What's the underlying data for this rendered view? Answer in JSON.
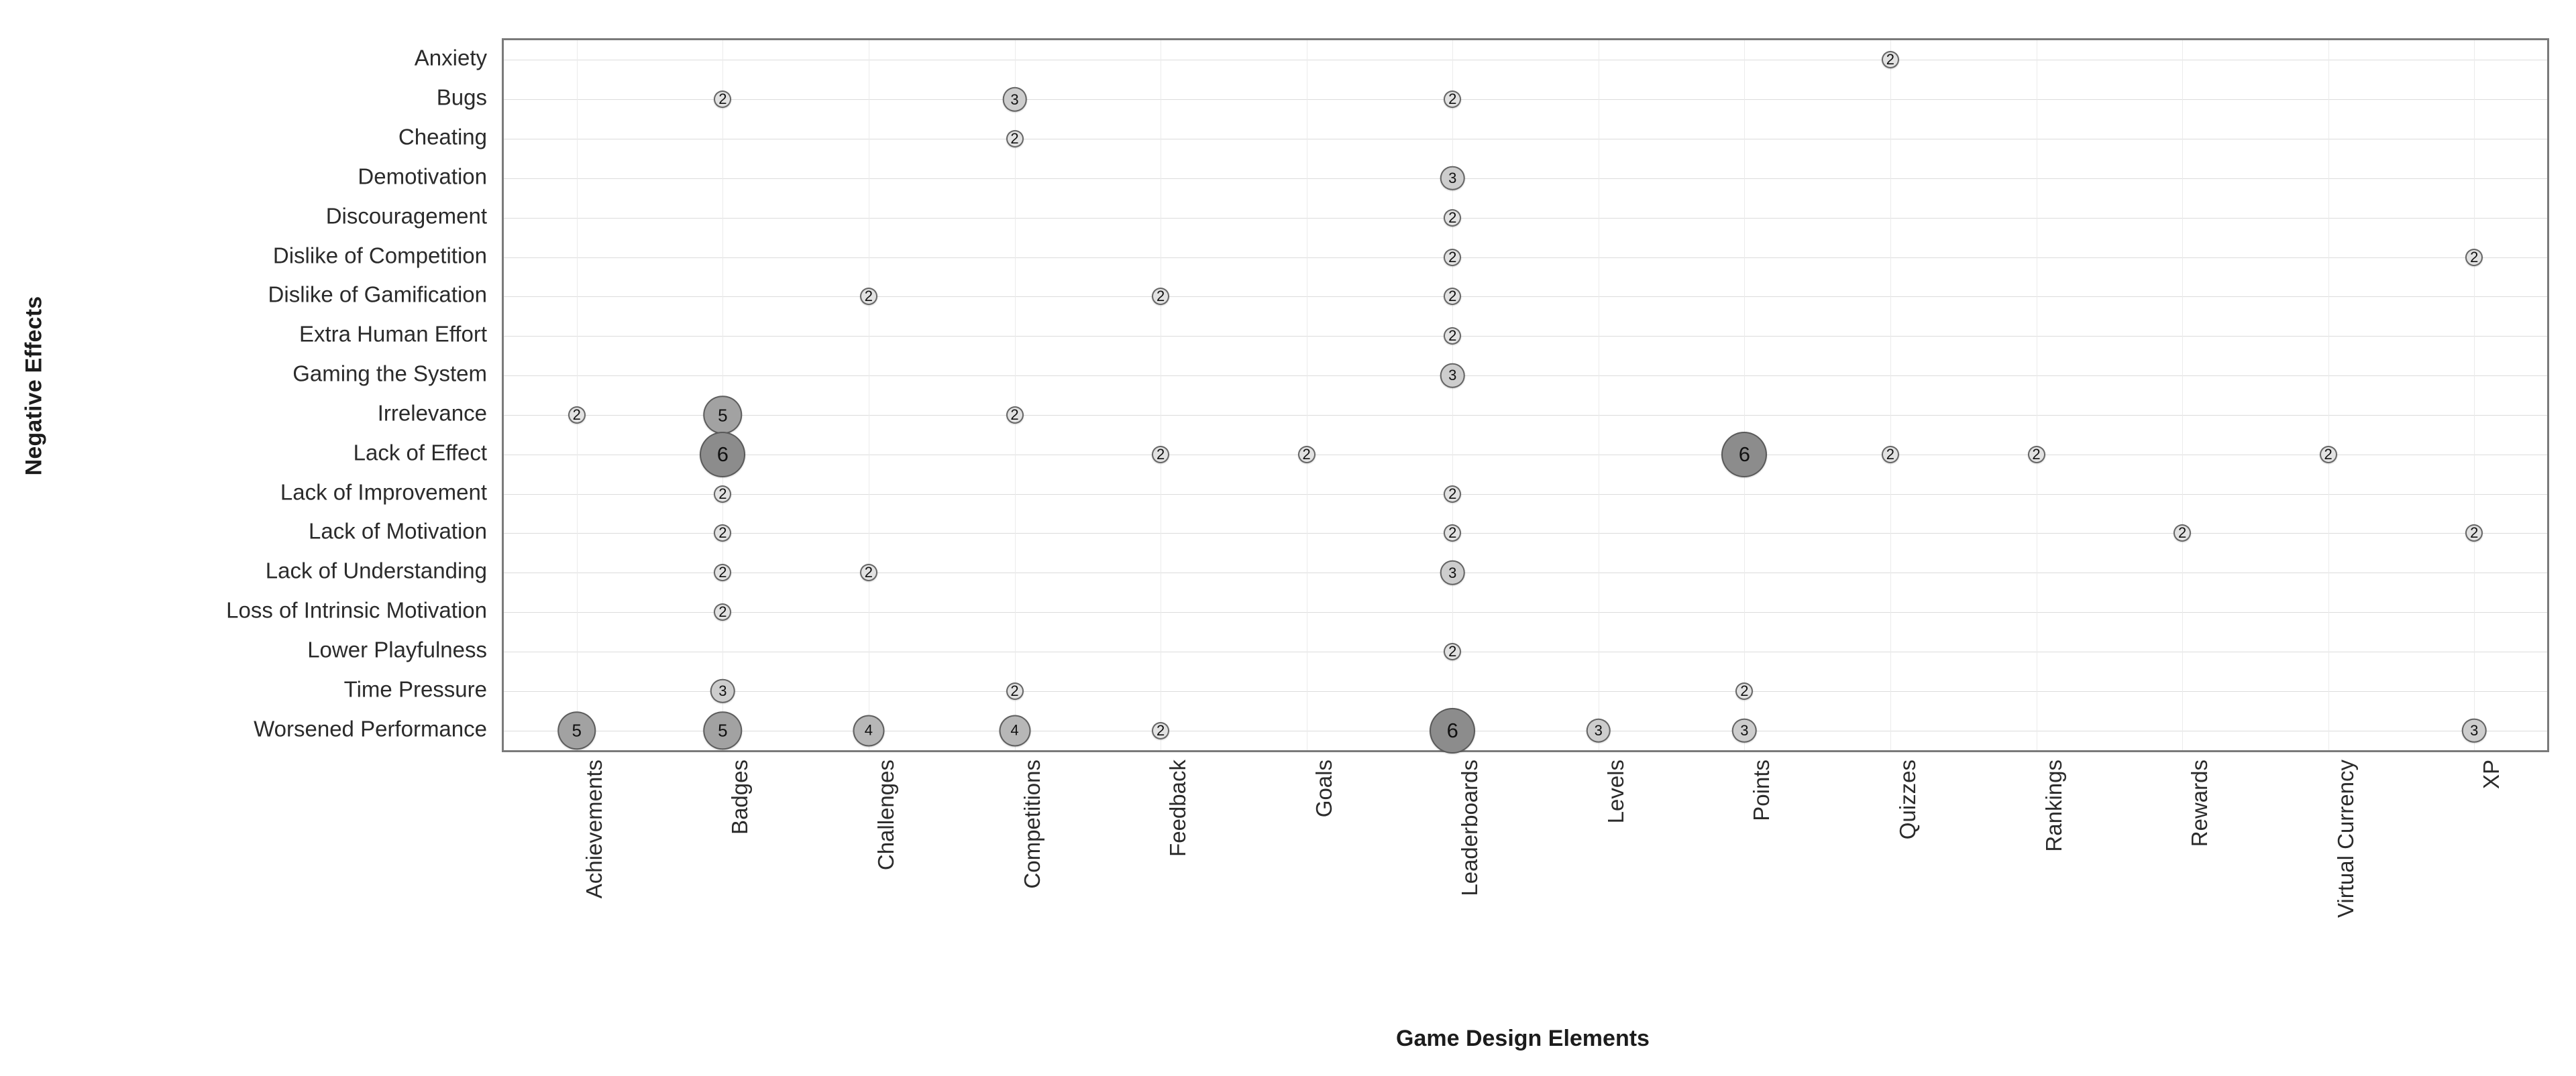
{
  "chart_data": {
    "type": "scatter",
    "title": "",
    "xlabel": "Game Design Elements",
    "ylabel": "Negative Effects",
    "grid": true,
    "legend": "none",
    "categories_x": [
      "Achievements",
      "Badges",
      "Challenges",
      "Competitions",
      "Feedback",
      "Goals",
      "Leaderboards",
      "Levels",
      "Points",
      "Quizzes",
      "Rankings",
      "Rewards",
      "Virtual Currency",
      "XP"
    ],
    "categories_y": [
      "Anxiety",
      "Bugs",
      "Cheating",
      "Demotivation",
      "Discouragement",
      "Dislike of Competition",
      "Dislike of Gamification",
      "Extra Human Effort",
      "Gaming the System",
      "Irrelevance",
      "Lack of Effect",
      "Lack of Improvement",
      "Lack of Motivation",
      "Lack of Understanding",
      "Loss of Intrinsic Motivation",
      "Lower Playfulness",
      "Time Pressure",
      "Worsened Performance"
    ],
    "value_range": [
      2,
      6
    ],
    "points": [
      {
        "x": "Quizzes",
        "y": "Anxiety",
        "value": 2
      },
      {
        "x": "Badges",
        "y": "Bugs",
        "value": 2
      },
      {
        "x": "Competitions",
        "y": "Bugs",
        "value": 3
      },
      {
        "x": "Leaderboards",
        "y": "Bugs",
        "value": 2
      },
      {
        "x": "Competitions",
        "y": "Cheating",
        "value": 2
      },
      {
        "x": "Leaderboards",
        "y": "Demotivation",
        "value": 3
      },
      {
        "x": "Leaderboards",
        "y": "Discouragement",
        "value": 2
      },
      {
        "x": "Leaderboards",
        "y": "Dislike of Competition",
        "value": 2
      },
      {
        "x": "XP",
        "y": "Dislike of Competition",
        "value": 2
      },
      {
        "x": "Challenges",
        "y": "Dislike of Gamification",
        "value": 2
      },
      {
        "x": "Feedback",
        "y": "Dislike of Gamification",
        "value": 2
      },
      {
        "x": "Leaderboards",
        "y": "Dislike of Gamification",
        "value": 2
      },
      {
        "x": "Leaderboards",
        "y": "Extra Human Effort",
        "value": 2
      },
      {
        "x": "Leaderboards",
        "y": "Gaming the System",
        "value": 3
      },
      {
        "x": "Achievements",
        "y": "Irrelevance",
        "value": 2
      },
      {
        "x": "Badges",
        "y": "Irrelevance",
        "value": 5
      },
      {
        "x": "Competitions",
        "y": "Irrelevance",
        "value": 2
      },
      {
        "x": "Badges",
        "y": "Lack of Effect",
        "value": 6
      },
      {
        "x": "Feedback",
        "y": "Lack of Effect",
        "value": 2
      },
      {
        "x": "Goals",
        "y": "Lack of Effect",
        "value": 2
      },
      {
        "x": "Points",
        "y": "Lack of Effect",
        "value": 6
      },
      {
        "x": "Quizzes",
        "y": "Lack of Effect",
        "value": 2
      },
      {
        "x": "Rankings",
        "y": "Lack of Effect",
        "value": 2
      },
      {
        "x": "Virtual Currency",
        "y": "Lack of Effect",
        "value": 2
      },
      {
        "x": "Badges",
        "y": "Lack of Improvement",
        "value": 2
      },
      {
        "x": "Leaderboards",
        "y": "Lack of Improvement",
        "value": 2
      },
      {
        "x": "Badges",
        "y": "Lack of Motivation",
        "value": 2
      },
      {
        "x": "Leaderboards",
        "y": "Lack of Motivation",
        "value": 2
      },
      {
        "x": "Rewards",
        "y": "Lack of Motivation",
        "value": 2
      },
      {
        "x": "XP",
        "y": "Lack of Motivation",
        "value": 2
      },
      {
        "x": "Badges",
        "y": "Lack of Understanding",
        "value": 2
      },
      {
        "x": "Challenges",
        "y": "Lack of Understanding",
        "value": 2
      },
      {
        "x": "Leaderboards",
        "y": "Lack of Understanding",
        "value": 3
      },
      {
        "x": "Badges",
        "y": "Loss of Intrinsic Motivation",
        "value": 2
      },
      {
        "x": "Leaderboards",
        "y": "Lower Playfulness",
        "value": 2
      },
      {
        "x": "Badges",
        "y": "Time Pressure",
        "value": 3
      },
      {
        "x": "Competitions",
        "y": "Time Pressure",
        "value": 2
      },
      {
        "x": "Points",
        "y": "Time Pressure",
        "value": 2
      },
      {
        "x": "Achievements",
        "y": "Worsened Performance",
        "value": 5
      },
      {
        "x": "Badges",
        "y": "Worsened Performance",
        "value": 5
      },
      {
        "x": "Challenges",
        "y": "Worsened Performance",
        "value": 4
      },
      {
        "x": "Competitions",
        "y": "Worsened Performance",
        "value": 4
      },
      {
        "x": "Feedback",
        "y": "Worsened Performance",
        "value": 2
      },
      {
        "x": "Leaderboards",
        "y": "Worsened Performance",
        "value": 6
      },
      {
        "x": "Levels",
        "y": "Worsened Performance",
        "value": 3
      },
      {
        "x": "Points",
        "y": "Worsened Performance",
        "value": 3
      },
      {
        "x": "XP",
        "y": "Worsened Performance",
        "value": 3
      }
    ]
  },
  "axes": {
    "y_title": "Negative Effects",
    "x_title": "Game Design Elements"
  },
  "colors": {
    "plot_border": "#7a7a7a",
    "grid_line": "#dcdcdc",
    "bubble_light": "#e8e8e8",
    "bubble_mid": "#bdbdbd",
    "bubble_dark": "#8f8f8f",
    "label_text": "#2b2b2b",
    "title_text": "#1c1c1c",
    "background": "#ffffff"
  }
}
